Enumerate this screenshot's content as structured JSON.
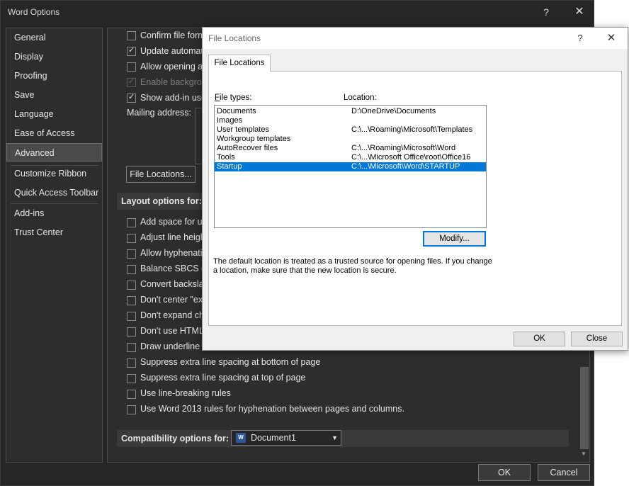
{
  "word_options": {
    "title": "Word Options",
    "help_glyph": "?",
    "close_glyph": "✕",
    "nav": [
      "General",
      "Display",
      "Proofing",
      "Save",
      "Language",
      "Ease of Access",
      "Advanced",
      "Customize Ribbon",
      "Quick Access Toolbar",
      "Add-ins",
      "Trust Center"
    ],
    "active_nav": "Advanced",
    "top_options": [
      {
        "label": "Confirm file form",
        "checked": false,
        "disabled": false
      },
      {
        "label": "Update automati",
        "checked": true,
        "disabled": false
      },
      {
        "label": "Allow opening a",
        "checked": false,
        "disabled": false
      },
      {
        "label": "Enable backgrou",
        "checked": true,
        "disabled": true
      },
      {
        "label": "Show add-in use",
        "checked": true,
        "disabled": false
      }
    ],
    "mailing_address_label": "Mailing address:",
    "file_locations_button": "File Locations...",
    "layout_header": "Layout options for:",
    "layout_options": [
      "Add space for ur",
      "Adjust line heigh",
      "Allow hyphenatio",
      "Balance SBCS cha",
      "Convert backslas",
      "Don't center \"exa",
      "Don't expand cha",
      "Don't use HTML",
      "Draw underline o",
      "Suppress extra line spacing at bottom of page",
      "Suppress extra line spacing at top of page",
      "Use line-breaking rules",
      "Use Word 2013 rules for hyphenation between pages and columns."
    ],
    "compat_header": "Compatibility options for:",
    "compat_value": "Document1",
    "ok_label": "OK",
    "cancel_label": "Cancel"
  },
  "file_locations": {
    "title": "File Locations",
    "help_glyph": "?",
    "close_glyph": "✕",
    "tab_label": "File Locations",
    "file_types_label": "File types:",
    "location_label": "Location:",
    "rows": [
      {
        "type": "Documents",
        "location": "D:\\OneDrive\\Documents"
      },
      {
        "type": "Images",
        "location": ""
      },
      {
        "type": "User templates",
        "location": "C:\\...\\Roaming\\Microsoft\\Templates"
      },
      {
        "type": "Workgroup templates",
        "location": ""
      },
      {
        "type": "AutoRecover files",
        "location": "C:\\...\\Roaming\\Microsoft\\Word"
      },
      {
        "type": "Tools",
        "location": "C:\\...\\Microsoft Office\\root\\Office16"
      },
      {
        "type": "Startup",
        "location": "C:\\...\\Microsoft\\Word\\STARTUP"
      }
    ],
    "selected_row": "Startup",
    "modify_label": "Modify...",
    "note": "The default location is treated as a trusted source for opening files. If you change a location, make sure that the new location is secure.",
    "ok_label": "OK",
    "close_label": "Close"
  }
}
